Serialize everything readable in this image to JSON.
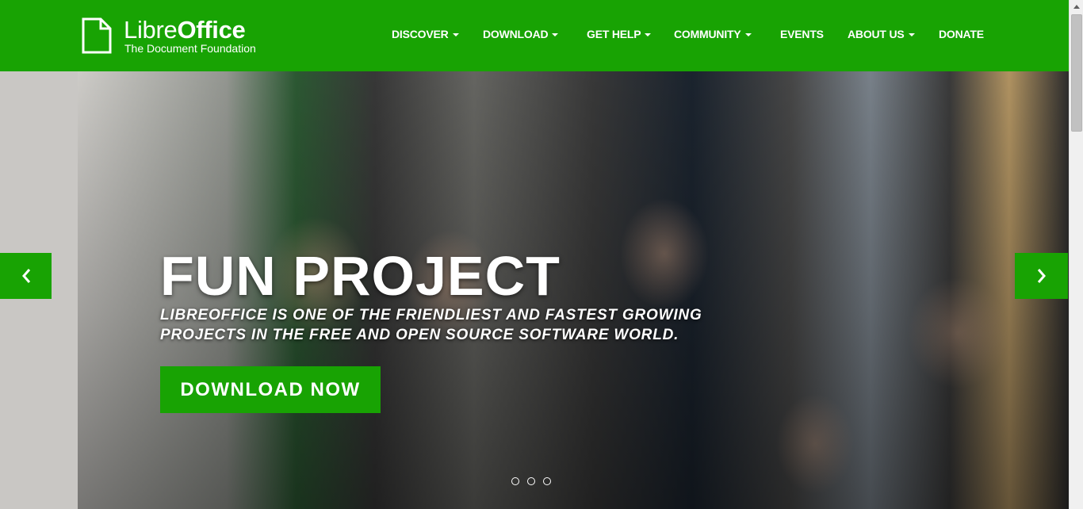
{
  "brand": {
    "name_part1": "Libre",
    "name_part2": "Office",
    "tagline": "The Document Foundation"
  },
  "nav": {
    "items": [
      {
        "label": "DISCOVER",
        "dropdown": true
      },
      {
        "label": "DOWNLOAD",
        "dropdown": true
      },
      {
        "label": "GET HELP",
        "dropdown": true
      },
      {
        "label": "COMMUNITY",
        "dropdown": true
      },
      {
        "label": "EVENTS",
        "dropdown": false
      },
      {
        "label": "ABOUT US",
        "dropdown": true
      },
      {
        "label": "DONATE",
        "dropdown": false
      }
    ]
  },
  "hero": {
    "title": "FUN PROJECT",
    "subtitle": "LIBREOFFICE IS ONE OF THE FRIENDLIEST AND FASTEST GROWING PROJECTS IN THE FREE AND OPEN SOURCE SOFTWARE WORLD.",
    "cta_label": "DOWNLOAD NOW",
    "prev_icon": "chevron-left-icon",
    "next_icon": "chevron-right-icon",
    "slide_count": 3
  },
  "colors": {
    "brand_green": "#18a303",
    "text_on_brand": "#ffffff"
  }
}
